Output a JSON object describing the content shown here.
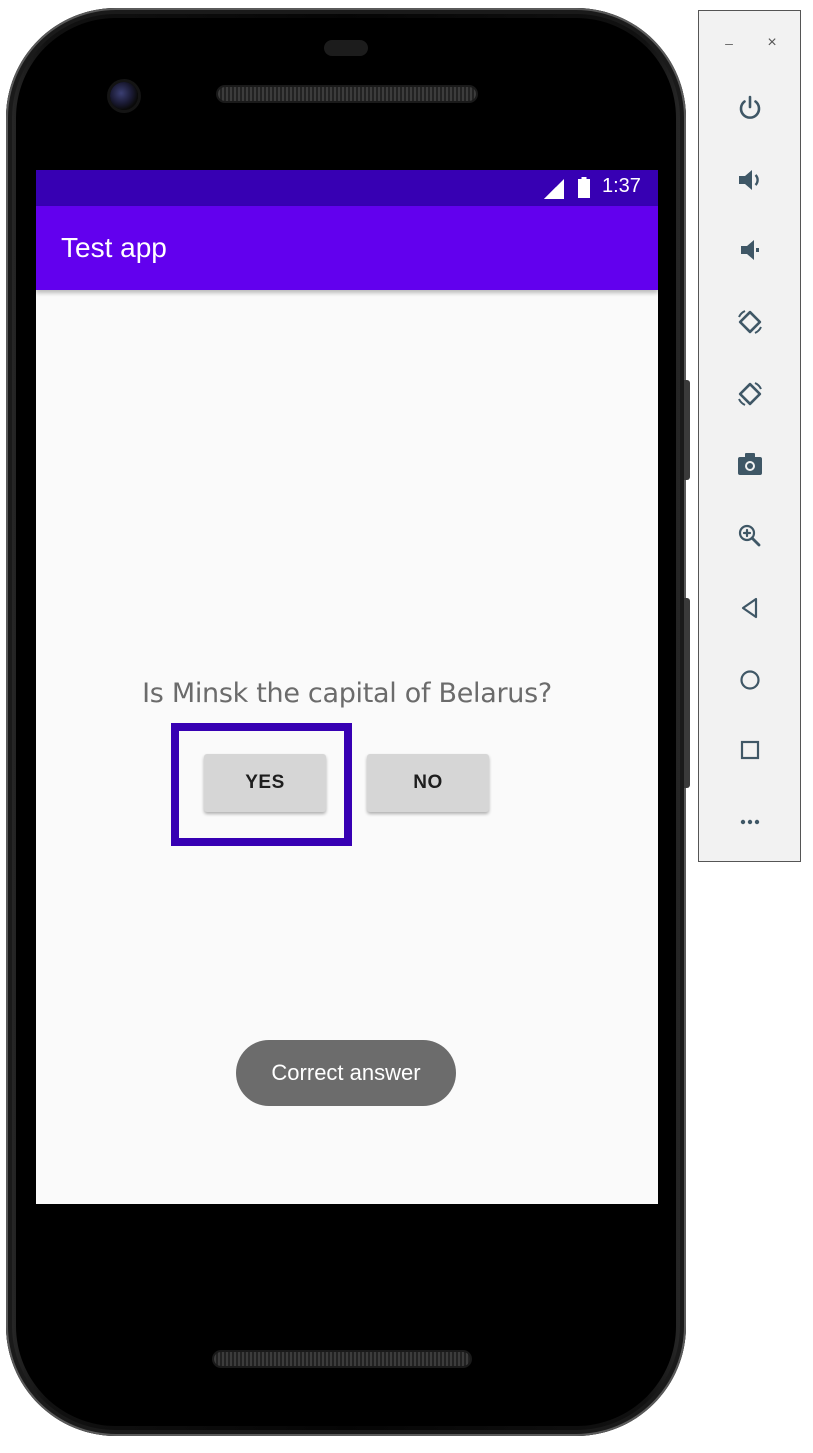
{
  "status_bar": {
    "time": "1:37"
  },
  "app_bar": {
    "title": "Test app"
  },
  "quiz": {
    "question": "Is Minsk the capital of Belarus?",
    "yes_label": "YES",
    "no_label": "NO"
  },
  "toast": {
    "message": "Correct answer"
  },
  "emulator_panel": {
    "minimize_glyph": "–",
    "close_glyph": "×",
    "controls": [
      "power-icon",
      "volume-up-icon",
      "volume-down-icon",
      "rotate-left-icon",
      "rotate-right-icon",
      "screenshot-icon",
      "zoom-icon",
      "back-icon",
      "home-icon",
      "overview-icon",
      "more-icon"
    ]
  },
  "colors": {
    "status_bar": "#3700b3",
    "app_bar": "#6200ee",
    "highlight": "#3700b3",
    "toast": "#6c6c6c",
    "button": "#d6d6d6",
    "panel_icon": "#3f5766"
  }
}
